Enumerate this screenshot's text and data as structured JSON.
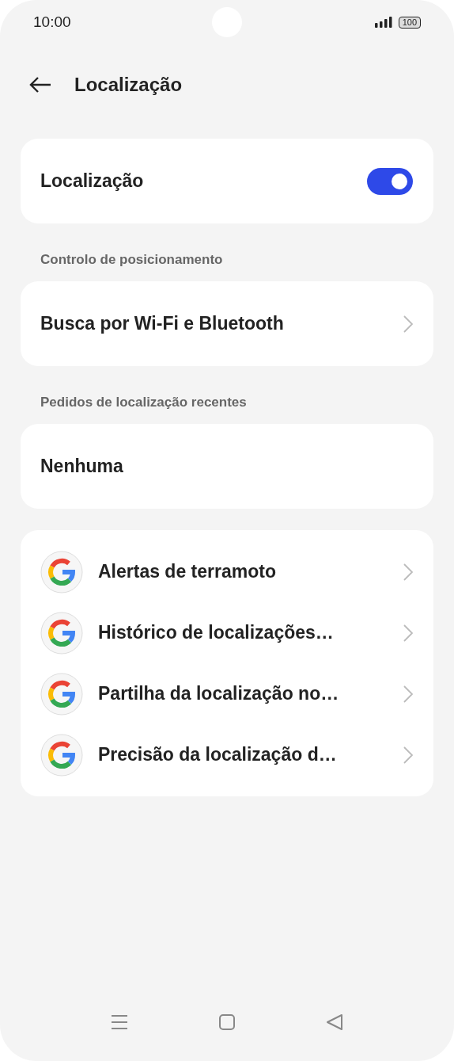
{
  "status_bar": {
    "time": "10:00",
    "battery": "100"
  },
  "header": {
    "title": "Localização"
  },
  "main_toggle": {
    "label": "Localização",
    "on": true
  },
  "sections": [
    {
      "heading": "Controlo de posicionamento",
      "items": [
        {
          "label": "Busca por Wi-Fi e Bluetooth",
          "kind": "link"
        }
      ]
    },
    {
      "heading": "Pedidos de localização recentes",
      "items": [
        {
          "label": "Nenhuma",
          "kind": "plain"
        }
      ]
    }
  ],
  "apps": [
    {
      "label": "Alertas de terramoto"
    },
    {
      "label": "Histórico de localizações…"
    },
    {
      "label": "Partilha da localização no…"
    },
    {
      "label": "Precisão da localização d…"
    }
  ]
}
